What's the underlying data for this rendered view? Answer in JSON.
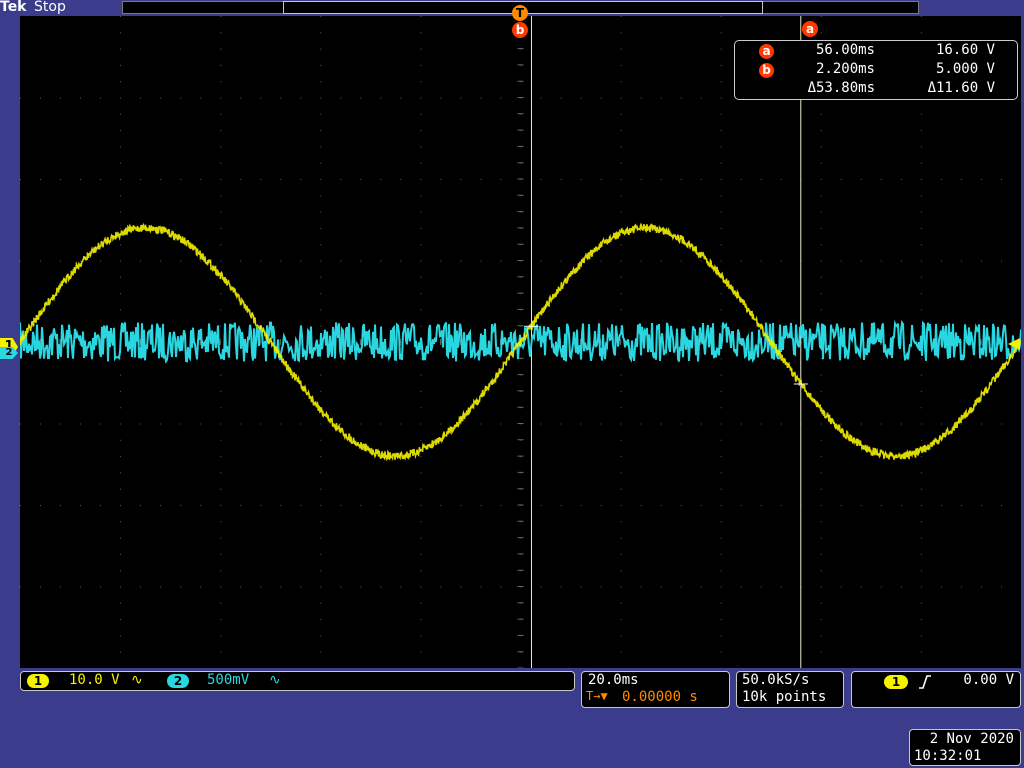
{
  "header": {
    "brand": "Tek",
    "status": "Stop",
    "trigger_marker": "T"
  },
  "cursors": {
    "a_label": "a",
    "b_label": "b",
    "readout": {
      "a": {
        "label": "a",
        "time": "56.00ms",
        "volts": "16.60 V"
      },
      "b": {
        "label": "b",
        "time": "2.200ms",
        "volts": "5.000 V"
      },
      "delta": {
        "time": "Δ53.80ms",
        "volts": "Δ11.60 V"
      }
    }
  },
  "channels": {
    "ch1": {
      "number": "1",
      "scale": "10.0 V",
      "coupling_icon": "∿",
      "color": "#f5f200"
    },
    "ch2": {
      "number": "2",
      "scale": "500mV",
      "coupling_icon": "∿",
      "color": "#2ad6e0"
    }
  },
  "horizontal": {
    "timebase": "20.0ms",
    "position": "0.00000 s",
    "trigger_position_icon": "T→▼"
  },
  "acquisition": {
    "sample_rate": "50.0kS/s",
    "record_length": "10k points"
  },
  "trigger": {
    "source": "1",
    "slope_icon": "rising-edge-icon",
    "level": "0.00 V"
  },
  "datetime": {
    "date": "2 Nov 2020",
    "time": "10:32:01"
  },
  "chart_data": {
    "type": "line",
    "title": "",
    "xlabel": "",
    "ylabel": "",
    "divisions": {
      "horizontal": 10,
      "vertical": 8
    },
    "series": [
      {
        "name": "1",
        "color": "#f5f200",
        "waveform": "sine",
        "frequency_hz": 10,
        "amplitude_volts": 14.0,
        "volts_per_div": 10.0,
        "time_per_div_ms": 20.0,
        "phase_zero_crossing_ms": 0.0,
        "offset_volts": 0
      },
      {
        "name": "2",
        "color": "#2ad6e0",
        "waveform": "noise",
        "amplitude_volts": 0.02,
        "volts_per_div": 0.5,
        "time_per_div_ms": 20.0,
        "offset_volts": 0
      }
    ],
    "cursor_a_ms": 56.0,
    "cursor_b_ms": 2.2,
    "x_range_ms": [
      -100,
      100
    ],
    "grid": true
  }
}
